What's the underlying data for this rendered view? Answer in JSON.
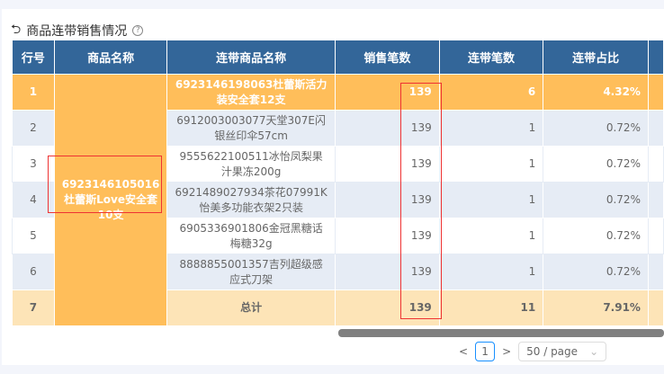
{
  "title": "商品连带销售情况",
  "headers": [
    "行号",
    "商品名称",
    "连带商品名称",
    "销售笔数",
    "连带笔数",
    "连带占比"
  ],
  "product": "6923146105016杜蕾斯Love安全套10支",
  "rows": [
    {
      "no": "1",
      "name": "6923146198063杜蕾斯活力装安全套12支",
      "sales": "139",
      "joint": "6",
      "ratio": "4.32%"
    },
    {
      "no": "2",
      "name": "6912003003077天堂307E闪银丝印伞57cm",
      "sales": "139",
      "joint": "1",
      "ratio": "0.72%"
    },
    {
      "no": "3",
      "name": "9555622100511冰怡凤梨果汁果冻200g",
      "sales": "139",
      "joint": "1",
      "ratio": "0.72%"
    },
    {
      "no": "4",
      "name": "6921489027934茶花07991K怡美多功能衣架2只装",
      "sales": "139",
      "joint": "1",
      "ratio": "0.72%"
    },
    {
      "no": "5",
      "name": "6905336901806金冠黑糖话梅糖32g",
      "sales": "139",
      "joint": "1",
      "ratio": "0.72%"
    },
    {
      "no": "6",
      "name": "8888855001357吉列超级感应式刀架",
      "sales": "139",
      "joint": "1",
      "ratio": "0.72%"
    }
  ],
  "total": {
    "no": "7",
    "label": "总计",
    "sales": "139",
    "joint": "11",
    "ratio": "7.91%"
  },
  "pager": {
    "prev": "<",
    "page": "1",
    "next": ">",
    "size": "50 / page",
    "chev": "⌄"
  }
}
